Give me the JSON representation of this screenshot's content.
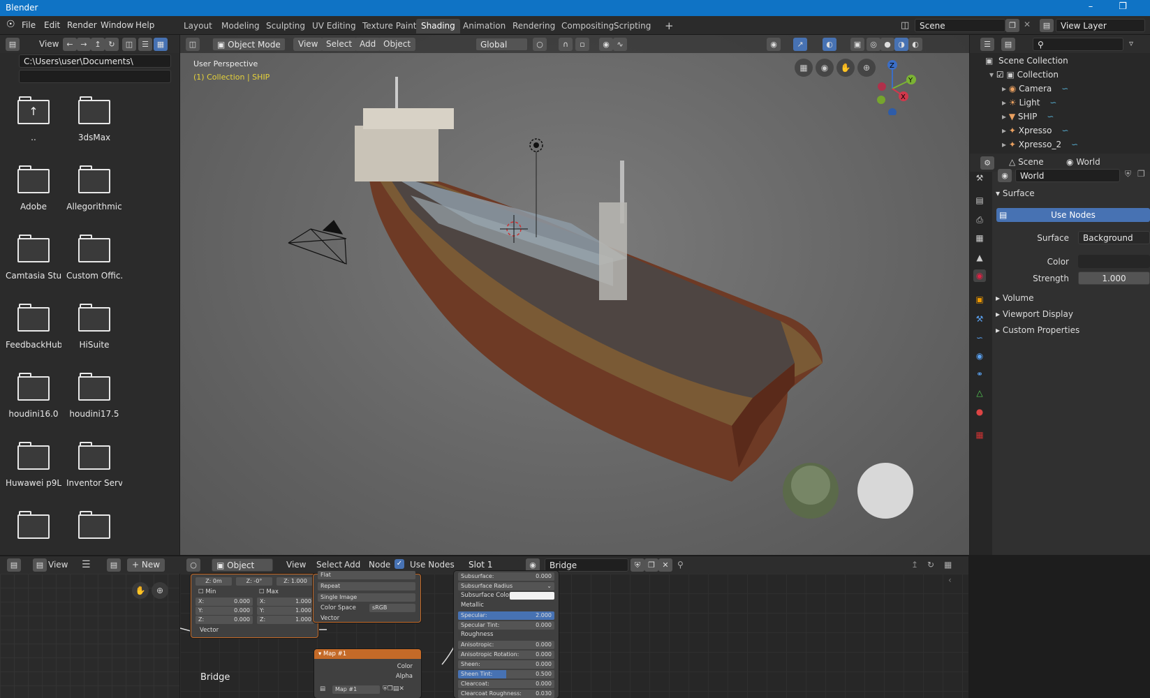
{
  "window": {
    "title": "Blender"
  },
  "menus": [
    "File",
    "Edit",
    "Render",
    "Window",
    "Help"
  ],
  "workspaces": [
    "Layout",
    "Modeling",
    "Sculpting",
    "UV Editing",
    "Texture Paint",
    "Shading",
    "Animation",
    "Rendering",
    "Compositing",
    "Scripting"
  ],
  "active_workspace": "Shading",
  "scene": {
    "name": "Scene",
    "view_layer": "View Layer"
  },
  "file_browser": {
    "view_label": "View",
    "path": "C:\\Users\\user\\Documents\\",
    "items": [
      "..",
      "3dsMax",
      "Adobe",
      "Allegorithmic",
      "Camtasia Stu..",
      "Custom Offic..",
      "FeedbackHub",
      "HiSuite",
      "houdini16.0",
      "houdini17.5",
      "Huwawei p9L..",
      "Inventor Serv..",
      "",
      ""
    ]
  },
  "viewport": {
    "mode": "Object Mode",
    "menus": [
      "View",
      "Select",
      "Add",
      "Object"
    ],
    "transform_orientation": "Global",
    "perspective": "User Perspective",
    "collection": "(1) Collection | SHIP",
    "gizmo": {
      "x": "X",
      "y": "Y",
      "z": "Z"
    }
  },
  "outliner": {
    "root": "Scene Collection",
    "collection": "Collection",
    "items": [
      "Camera",
      "Light",
      "SHIP",
      "Xpresso",
      "Xpresso_2"
    ]
  },
  "properties": {
    "tabs": [
      "Scene",
      "World"
    ],
    "world_name": "World",
    "surface_label": "Surface",
    "use_nodes": "Use Nodes",
    "surface_field_label": "Surface",
    "surface_value": "Background",
    "color_label": "Color",
    "strength_label": "Strength",
    "strength_value": "1.000",
    "collapsed": [
      "Volume",
      "Viewport Display",
      "Custom Properties"
    ]
  },
  "image_editor": {
    "view": "View",
    "new": "New",
    "label": "Bridge"
  },
  "node_editor": {
    "type": "Object",
    "menus": [
      "View",
      "Select",
      "Add",
      "Node"
    ],
    "use_nodes": "Use Nodes",
    "slot": "Slot 1",
    "material": "Bridge"
  },
  "mapping_node": {
    "row1": [
      "Z: 0m",
      "Z: -0°",
      "Z: 1.000"
    ],
    "min": "Min",
    "max": "Max",
    "min_vals": [
      [
        "X:",
        "0.000"
      ],
      [
        "Y:",
        "0.000"
      ],
      [
        "Z:",
        "0.000"
      ]
    ],
    "max_vals": [
      [
        "X:",
        "1.000"
      ],
      [
        "Y:",
        "1.000"
      ],
      [
        "Z:",
        "1.000"
      ]
    ],
    "vector": "Vector"
  },
  "image_node": {
    "fields": [
      "Flat",
      "Repeat",
      "Single Image"
    ],
    "color_space_label": "Color Space",
    "color_space": "sRGB",
    "vector": "Vector"
  },
  "map_node": {
    "title": "Map #1",
    "color": "Color",
    "alpha": "Alpha",
    "image": "Map #1"
  },
  "bsdf_node": {
    "rows": [
      {
        "label": "Subsurface:",
        "value": "0.000",
        "type": "field"
      },
      {
        "label": "Subsurface Radius",
        "value": "",
        "type": "select"
      },
      {
        "label": "Subsurface Color",
        "value": "",
        "type": "color"
      },
      {
        "label": "Metallic",
        "value": "",
        "type": "socket"
      },
      {
        "label": "Specular:",
        "value": "2.000",
        "type": "blue"
      },
      {
        "label": "Specular Tint:",
        "value": "0.000",
        "type": "field"
      },
      {
        "label": "Roughness",
        "value": "",
        "type": "socket"
      },
      {
        "label": "Anisotropic:",
        "value": "0.000",
        "type": "field"
      },
      {
        "label": "Anisotropic Rotation:",
        "value": "0.000",
        "type": "field"
      },
      {
        "label": "Sheen:",
        "value": "0.000",
        "type": "field"
      },
      {
        "label": "Sheen Tint:",
        "value": "0.500",
        "type": "half"
      },
      {
        "label": "Clearcoat:",
        "value": "0.000",
        "type": "field"
      },
      {
        "label": "Clearcoat Roughness:",
        "value": "0.030",
        "type": "field"
      }
    ]
  }
}
